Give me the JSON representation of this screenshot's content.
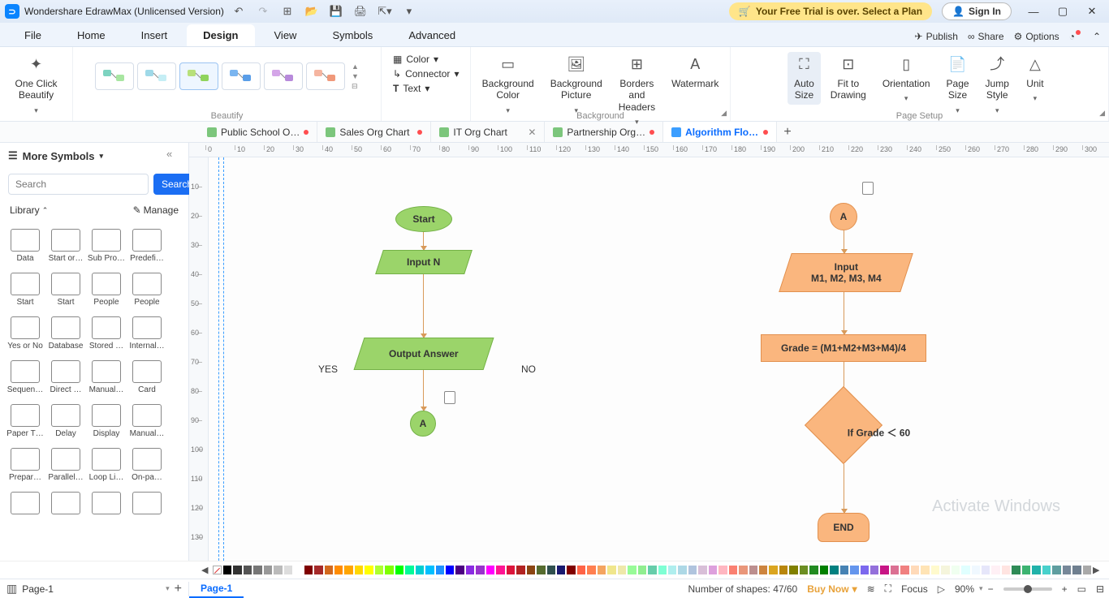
{
  "app": {
    "title": "Wondershare EdrawMax (Unlicensed Version)"
  },
  "titlebar": {
    "trial": "Your Free Trial is over. Select a Plan",
    "signin": "Sign In"
  },
  "menu": {
    "items": [
      "File",
      "Home",
      "Insert",
      "Design",
      "View",
      "Symbols",
      "Advanced"
    ],
    "active": 3,
    "publish": "Publish",
    "share": "Share",
    "options": "Options"
  },
  "ribbon": {
    "oneclick": "One Click\nBeautify",
    "beautify": "Beautify",
    "color": "Color",
    "connector": "Connector",
    "text": "Text",
    "bg_color": "Background\nColor",
    "bg_picture": "Background\nPicture",
    "borders": "Borders and\nHeaders",
    "watermark": "Watermark",
    "background": "Background",
    "autosize": "Auto\nSize",
    "fit": "Fit to\nDrawing",
    "orientation": "Orientation",
    "pagesize": "Page\nSize",
    "jumpstyle": "Jump\nStyle",
    "unit": "Unit",
    "pagesetup": "Page Setup"
  },
  "tabs": [
    {
      "name": "Public School O…",
      "modified": true
    },
    {
      "name": "Sales Org Chart",
      "modified": true
    },
    {
      "name": "IT Org Chart",
      "modified": false,
      "close": true
    },
    {
      "name": "Partnership Org…",
      "modified": true
    },
    {
      "name": "Algorithm Flo…",
      "modified": true,
      "active": true
    }
  ],
  "left": {
    "more": "More Symbols",
    "search_ph": "Search",
    "search_btn": "Search",
    "library": "Library",
    "manage": "Manage",
    "shapes": [
      [
        "Data",
        "Start or…",
        "Sub Pro…",
        "Predefi…"
      ],
      [
        "Start",
        "Start",
        "People",
        "People"
      ],
      [
        "Yes or No",
        "Database",
        "Stored …",
        "Internal…"
      ],
      [
        "Sequen…",
        "Direct …",
        "Manual…",
        "Card"
      ],
      [
        "Paper T…",
        "Delay",
        "Display",
        "Manual…"
      ],
      [
        "Prepar…",
        "Parallel…",
        "Loop Li…",
        "On-pa…"
      ],
      [
        "",
        "",
        "",
        ""
      ]
    ]
  },
  "flow": {
    "start": "Start",
    "inputN": "Input N",
    "output": "Output Answer",
    "A": "A",
    "yes": "YES",
    "no": "NO",
    "A2": "A",
    "inputM": "Input\nM1, M2, M3, M4",
    "grade": "Grade =  (M1+M2+M3+M4)/4",
    "cond": "If Grade ＜ 60",
    "end": "END"
  },
  "status": {
    "page": "Page-1",
    "pagetab": "Page-1",
    "shapes": "Number of shapes: 47/60",
    "buynow": "Buy Now",
    "focus": "Focus",
    "zoom": "90%"
  },
  "watermark": "Activate Windows",
  "colors": [
    "#000",
    "#333",
    "#555",
    "#777",
    "#999",
    "#bbb",
    "#ddd",
    "#fff",
    "#7f0000",
    "#a52a2a",
    "#d2691e",
    "#ff8c00",
    "#ffa500",
    "#ffd700",
    "#ffff00",
    "#adff2f",
    "#7fff00",
    "#00ff00",
    "#00fa9a",
    "#00ced1",
    "#00bfff",
    "#1e90ff",
    "#0000ff",
    "#4b0082",
    "#8a2be2",
    "#9932cc",
    "#ff00ff",
    "#ff1493",
    "#dc143c",
    "#b22222",
    "#8b4513",
    "#556b2f",
    "#2f4f4f",
    "#191970",
    "#800000",
    "#ff6347",
    "#ff7f50",
    "#f4a460",
    "#f0e68c",
    "#eee8aa",
    "#98fb98",
    "#90ee90",
    "#66cdaa",
    "#7fffd4",
    "#afeeee",
    "#add8e6",
    "#b0c4de",
    "#d8bfd8",
    "#dda0dd",
    "#ffb6c1",
    "#fa8072",
    "#e9967a",
    "#bc8f8f",
    "#cd853f",
    "#daa520",
    "#b8860b",
    "#808000",
    "#6b8e23",
    "#228b22",
    "#008000",
    "#008080",
    "#4682b4",
    "#6495ed",
    "#7b68ee",
    "#9370db",
    "#c71585",
    "#db7093",
    "#f08080",
    "#ffdab9",
    "#ffe4b5",
    "#fffacd",
    "#f5f5dc",
    "#f0fff0",
    "#e0ffff",
    "#f0f8ff",
    "#e6e6fa",
    "#fff0f5",
    "#ffe4e1",
    "#2e8b57",
    "#3cb371",
    "#20b2aa",
    "#48d1cc",
    "#5f9ea0",
    "#778899",
    "#708090",
    "#a9a9a9"
  ]
}
